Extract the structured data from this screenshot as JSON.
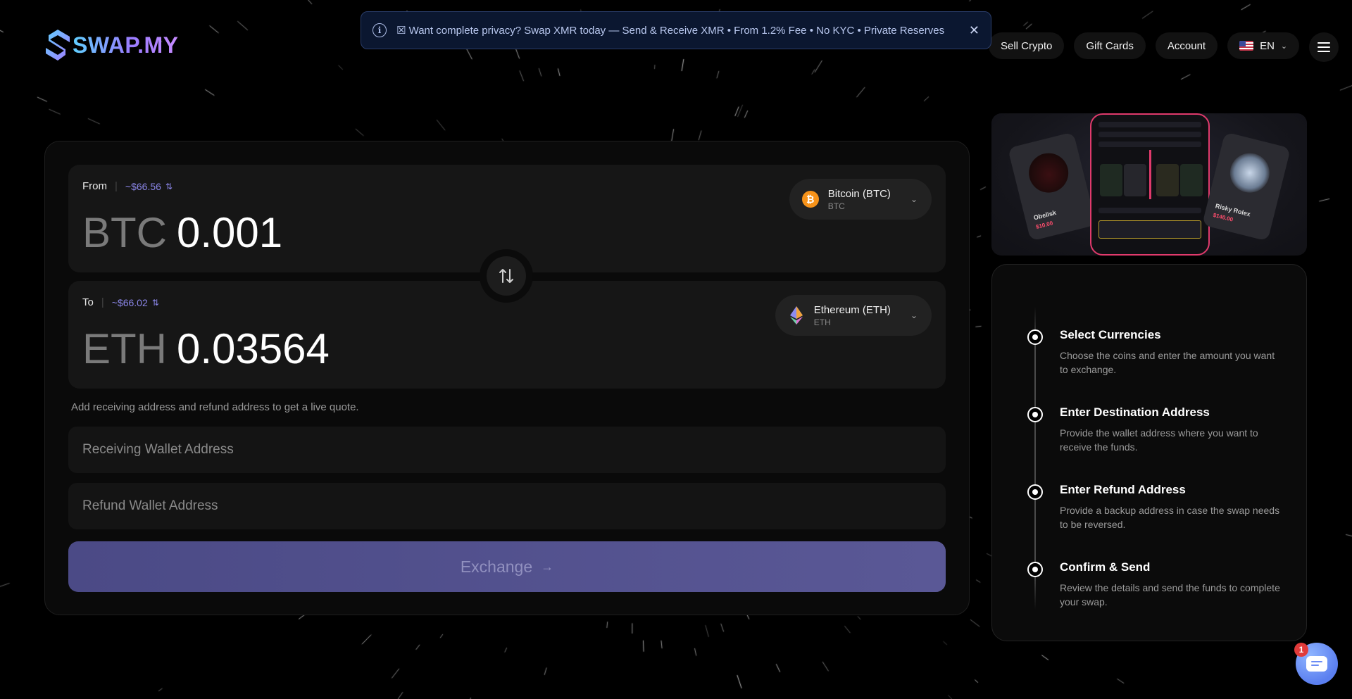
{
  "brand": {
    "name": "SWAP.MY"
  },
  "banner": {
    "text": "☒ Want complete privacy? Swap XMR today — Send & Receive XMR • From 1.2% Fee • No KYC • Private Reserves",
    "info_icon": "info-icon",
    "close_icon": "close-icon",
    "close_symbol": "✕"
  },
  "nav": {
    "items": [
      "Sell Crypto",
      "Gift Cards",
      "Account"
    ],
    "language": "EN",
    "language_flag": "us-flag-icon",
    "menu_icon": "hamburger-icon"
  },
  "exchange": {
    "from": {
      "label": "From",
      "usd_estimate": "~$66.56",
      "ticker": "BTC",
      "amount": "0.001",
      "coin_name": "Bitcoin (BTC)",
      "coin_symbol": "BTC",
      "icon_glyph": "₿",
      "icon_color": "#f7931a"
    },
    "to": {
      "label": "To",
      "usd_estimate": "~$66.02",
      "ticker": "ETH",
      "amount": "0.03564",
      "coin_name": "Ethereum (ETH)",
      "coin_symbol": "ETH"
    },
    "hint": "Add receiving address and refund address to get a live quote.",
    "receiving_placeholder": "Receiving Wallet Address",
    "refund_placeholder": "Refund Wallet Address",
    "button_label": "Exchange",
    "button_arrow": "→"
  },
  "promo": {
    "left_card": {
      "name": "Obelisk",
      "price": "$10.00"
    },
    "right_card": {
      "name": "Risky Rolex",
      "price": "$140.00"
    }
  },
  "steps": [
    {
      "title": "Select Currencies",
      "description": "Choose the coins and enter the amount you want to exchange."
    },
    {
      "title": "Enter Destination Address",
      "description": "Provide the wallet address where you want to receive the funds."
    },
    {
      "title": "Enter Refund Address",
      "description": "Provide a backup address in case the swap needs to be reversed."
    },
    {
      "title": "Confirm & Send",
      "description": "Review the details and send the funds to complete your swap."
    }
  ],
  "chat": {
    "badge_count": "1",
    "icon": "chat-icon"
  },
  "colors": {
    "accent": "#8b86e8",
    "button": "#4b4a86",
    "background": "#000000",
    "chat": "#5b7ff0"
  }
}
